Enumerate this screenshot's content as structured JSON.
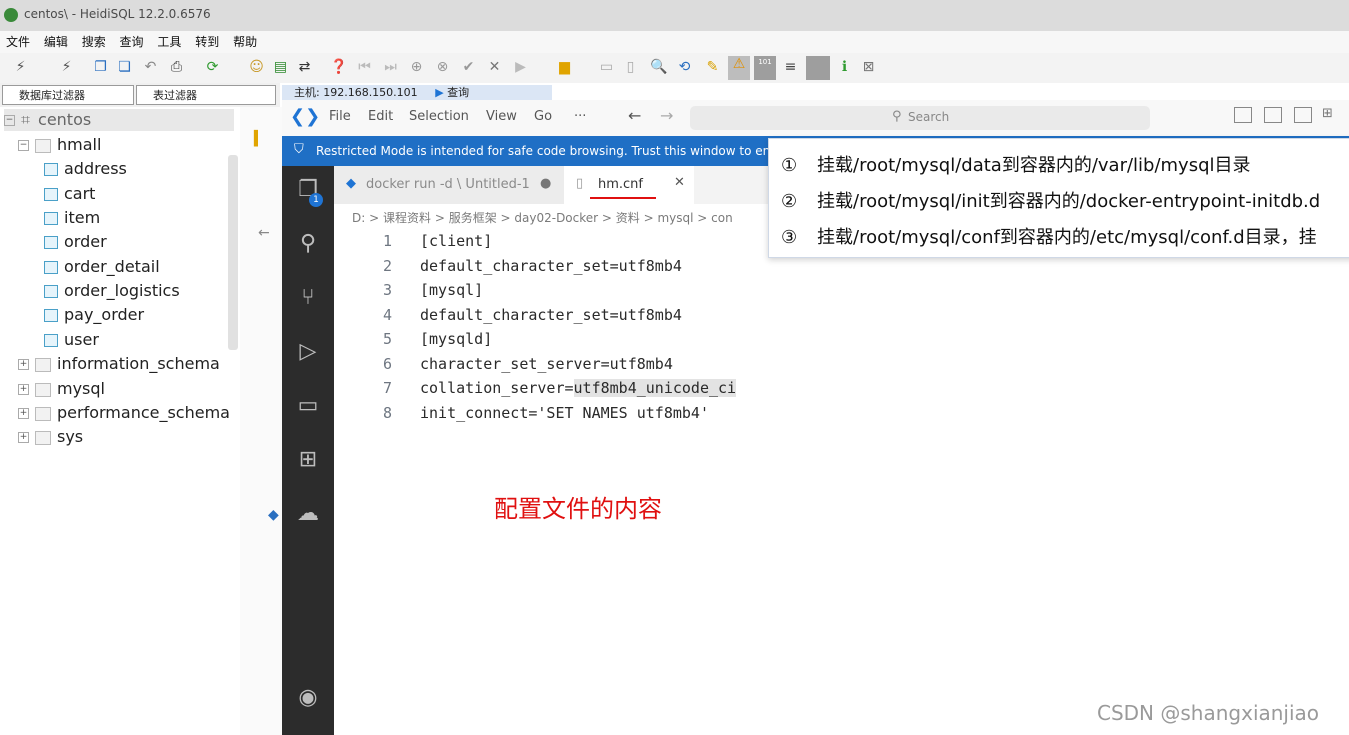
{
  "heidi": {
    "window_title": "centos\\ - HeidiSQL 12.2.0.6576",
    "menu": [
      "文件",
      "编辑",
      "搜索",
      "查询",
      "工具",
      "转到",
      "帮助"
    ],
    "db_filter_label": "数据库过滤器",
    "table_filter_label": "表过滤器",
    "host_tab_label": "主机: 192.168.150.101",
    "query_tab_label": "查询",
    "tree": {
      "connection": "centos",
      "database": "hmall",
      "tables": [
        "address",
        "cart",
        "item",
        "order",
        "order_detail",
        "order_logistics",
        "pay_order",
        "user"
      ],
      "other_databases": [
        "information_schema",
        "mysql",
        "performance_schema",
        "sys"
      ]
    }
  },
  "vscode": {
    "menu": [
      "File",
      "Edit",
      "Selection",
      "View",
      "Go",
      "···"
    ],
    "search_placeholder": "Search",
    "restricted_banner": "Restricted Mode is intended for safe code browsing. Trust this window to ena",
    "tabs": [
      {
        "label": "docker run -d \\ Untitled-1",
        "active": false
      },
      {
        "label": "hm.cnf",
        "active": true
      }
    ],
    "badge": "1",
    "breadcrumb": [
      "D:",
      "课程资料",
      "服务框架",
      "day02-Docker",
      "资料",
      "mysql",
      "con"
    ],
    "lines": [
      {
        "n": "1",
        "text": "[client]"
      },
      {
        "n": "2",
        "text": "default_character_set=utf8mb4"
      },
      {
        "n": "3",
        "text": "[mysql]"
      },
      {
        "n": "4",
        "text": "default_character_set=utf8mb4"
      },
      {
        "n": "5",
        "text": "[mysqld]"
      },
      {
        "n": "6",
        "text": "character_set_server=utf8mb4"
      },
      {
        "n": "7a",
        "text": "collation_server="
      },
      {
        "n": "7b",
        "text": "utf8mb4_unicode_ci"
      },
      {
        "n": "8",
        "text": "init_connect='SET NAMES utf8mb4'"
      }
    ]
  },
  "callout": {
    "items": [
      {
        "num": "①",
        "text": "挂载/root/mysql/data到容器内的/var/lib/mysql目录"
      },
      {
        "num": "②",
        "text": "挂载/root/mysql/init到容器内的/docker-entrypoint-initdb.d"
      },
      {
        "num": "③",
        "text": "挂载/root/mysql/conf到容器内的/etc/mysql/conf.d目录，挂"
      }
    ]
  },
  "annotation": "配置文件的内容",
  "watermark": "CSDN @shangxianjiao",
  "colors": {
    "annotation": "#e01010",
    "vscode_blue": "#1f6fc5",
    "activity_bar": "#2c2c2c"
  }
}
